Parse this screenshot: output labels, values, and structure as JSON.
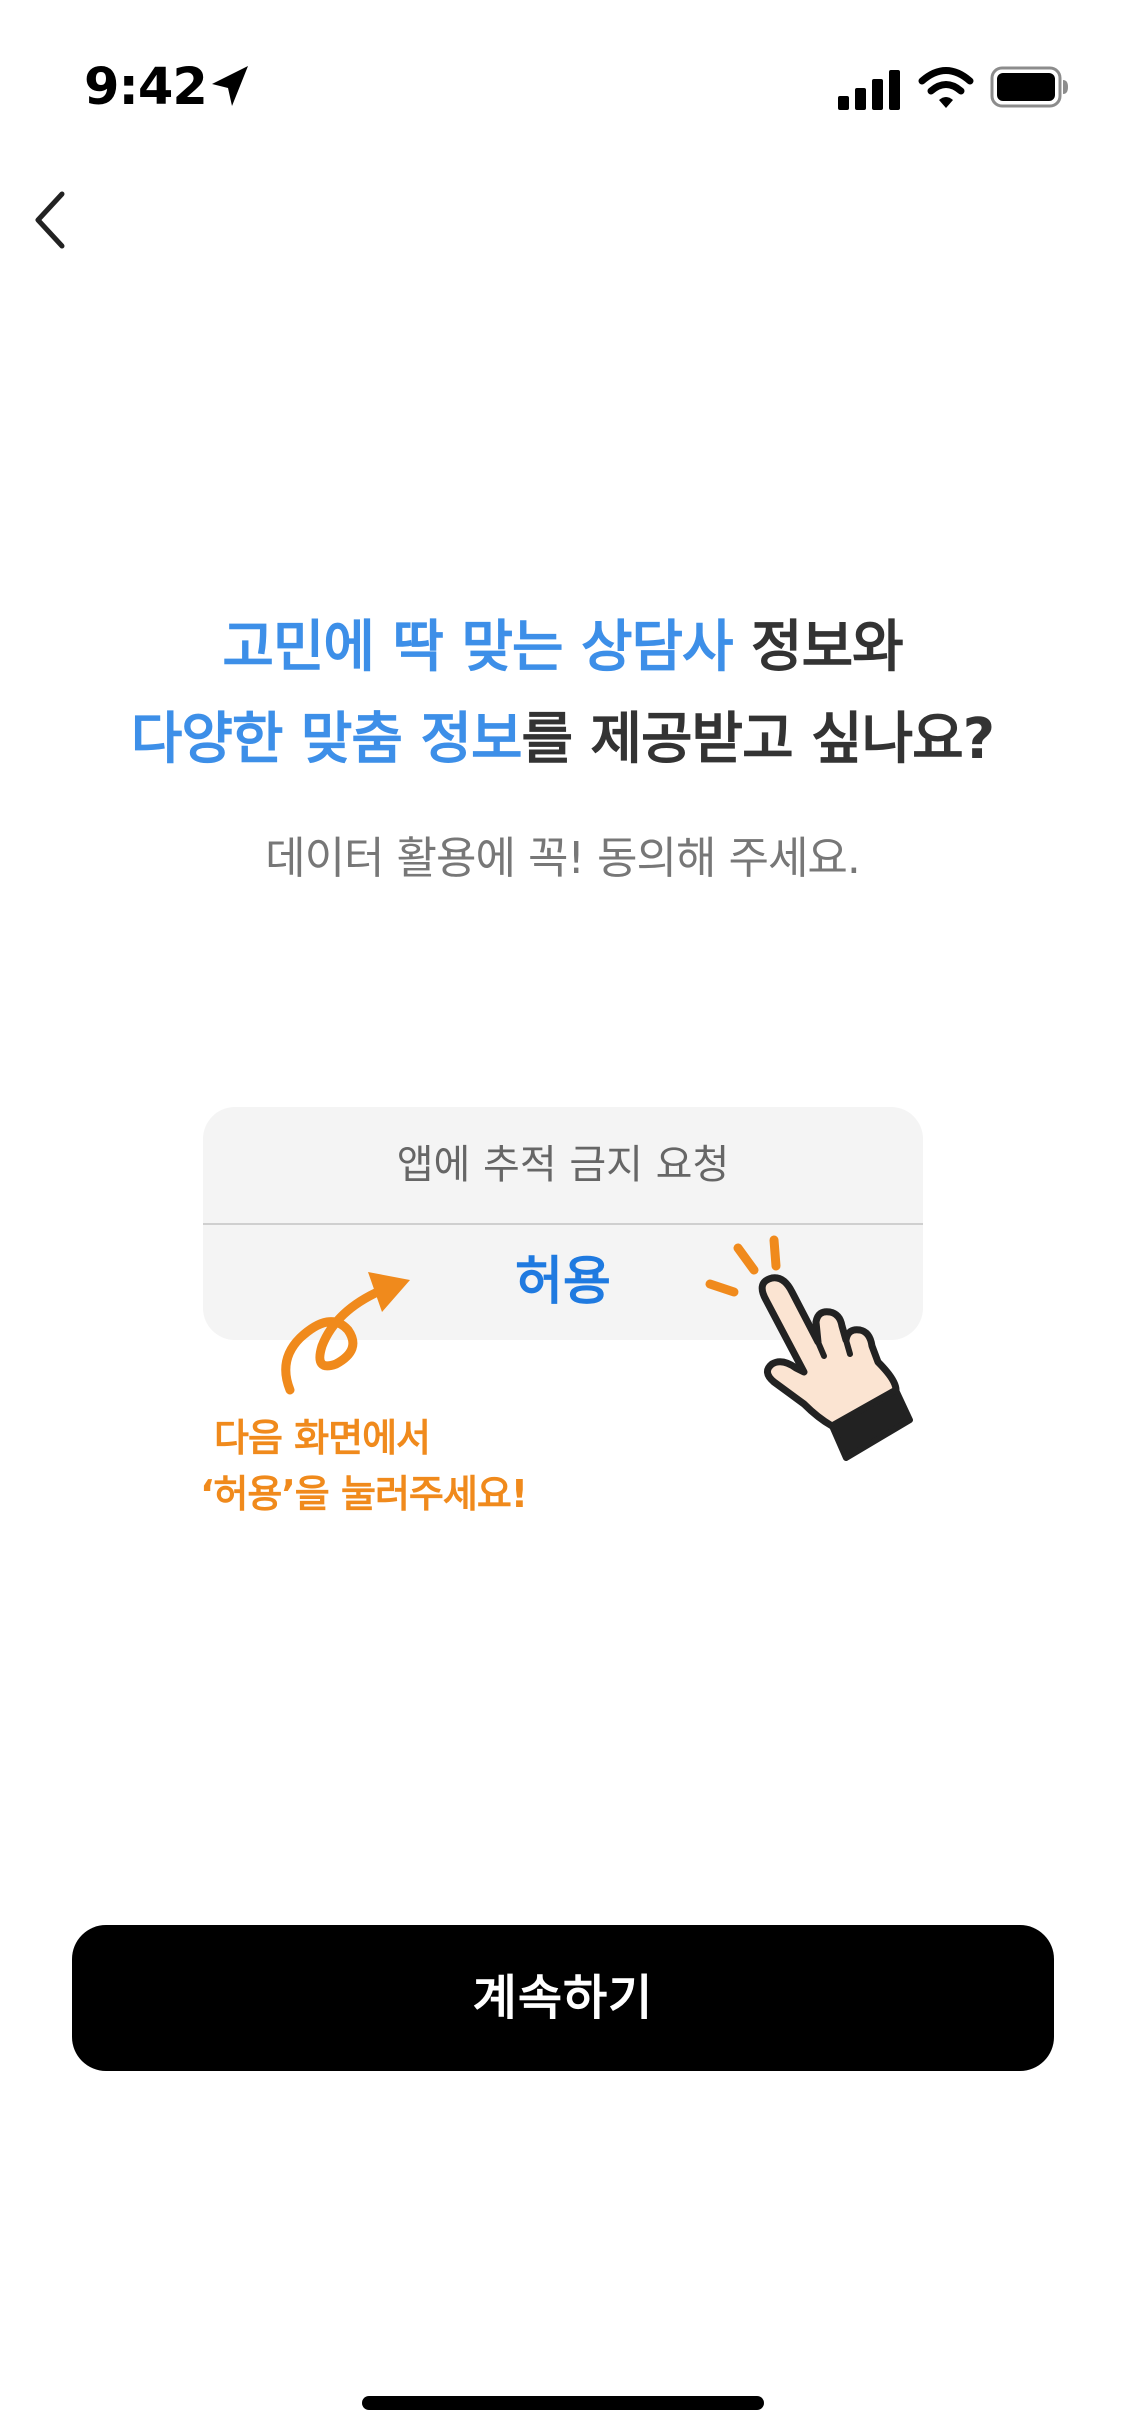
{
  "status_bar": {
    "time": "9:42",
    "icons": [
      "location-arrow-icon",
      "cellular-signal-icon",
      "wifi-icon",
      "battery-icon"
    ]
  },
  "nav": {
    "back_icon": "chevron-left-icon"
  },
  "headline": {
    "line1_accent": "고민에 딱 맞는 상담사",
    "line1_rest": " 정보와",
    "line2_accent": "다양한 맞춤 정보",
    "line2_rest": "를 제공받고 싶나요?"
  },
  "subtitle": "데이터 활용에 꼭! 동의해 주세요.",
  "mock_dialog": {
    "ask_not_to_track": "앱에 추적 금지 요청",
    "allow": "허용"
  },
  "annotation": {
    "line1": "다음 화면에서",
    "line2": "‘허용’을 눌러주세요!"
  },
  "continue_button": "계속하기",
  "colors": {
    "accent_blue": "#3d8fe8",
    "allow_blue": "#1f7ae0",
    "annotation_orange": "#f08a1c",
    "button_black": "#000000"
  }
}
